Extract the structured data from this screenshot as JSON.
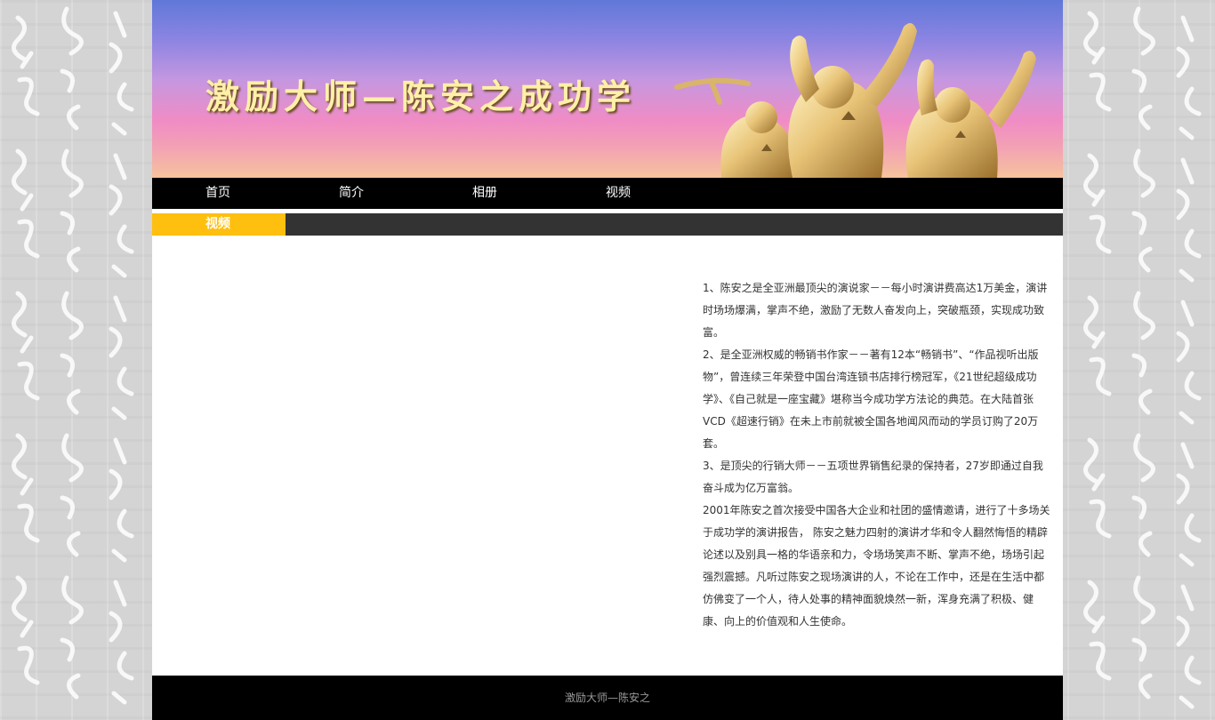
{
  "banner": {
    "title": "激励大师—陈安之成功学"
  },
  "nav": {
    "items": [
      {
        "label": "首页"
      },
      {
        "label": "简介"
      },
      {
        "label": "相册"
      },
      {
        "label": "视频"
      }
    ]
  },
  "section": {
    "title": "视频"
  },
  "intro": {
    "paragraphs": [
      "1、陈安之是全亚洲最顶尖的演说家－－每小时演讲费高达1万美金，演讲时场场爆满，掌声不绝，激励了无数人奋发向上，突破瓶颈，实现成功致富。",
      "2、是全亚洲权威的畅销书作家－－著有12本“畅销书”、“作品视听出版物”，曾连续三年荣登中国台湾连锁书店排行榜冠军，《21世纪超级成功学》、《自己就是一座宝藏》堪称当今成功学方法论的典范。在大陆首张VCD《超速行销》在未上市前就被全国各地闻风而动的学员订购了20万套。",
      "3、是顶尖的行销大师－－五项世界销售纪录的保持者，27岁即通过自我奋斗成为亿万富翁。",
      "2001年陈安之首次接受中国各大企业和社团的盛情邀请，进行了十多场关于成功学的演讲报告， 陈安之魅力四射的演讲才华和令人翻然悔悟的精辟论述以及别具一格的华语亲和力，令场场笑声不断、掌声不绝，场场引起强烈震撼。凡听过陈安之现场演讲的人，不论在工作中，还是在生活中都仿佛变了一个人，待人处事的精神面貌焕然一新，浑身充满了积极、健康、向上的价值观和人生使命。"
    ]
  },
  "footer": {
    "text": "激励大师—陈安之"
  },
  "colors": {
    "nav_bg": "#000000",
    "section_tab": "#ffbf0f",
    "section_bar": "#333333",
    "footer_bg": "#000000"
  },
  "icons": {
    "banner_art": "golden-climber-statue"
  }
}
